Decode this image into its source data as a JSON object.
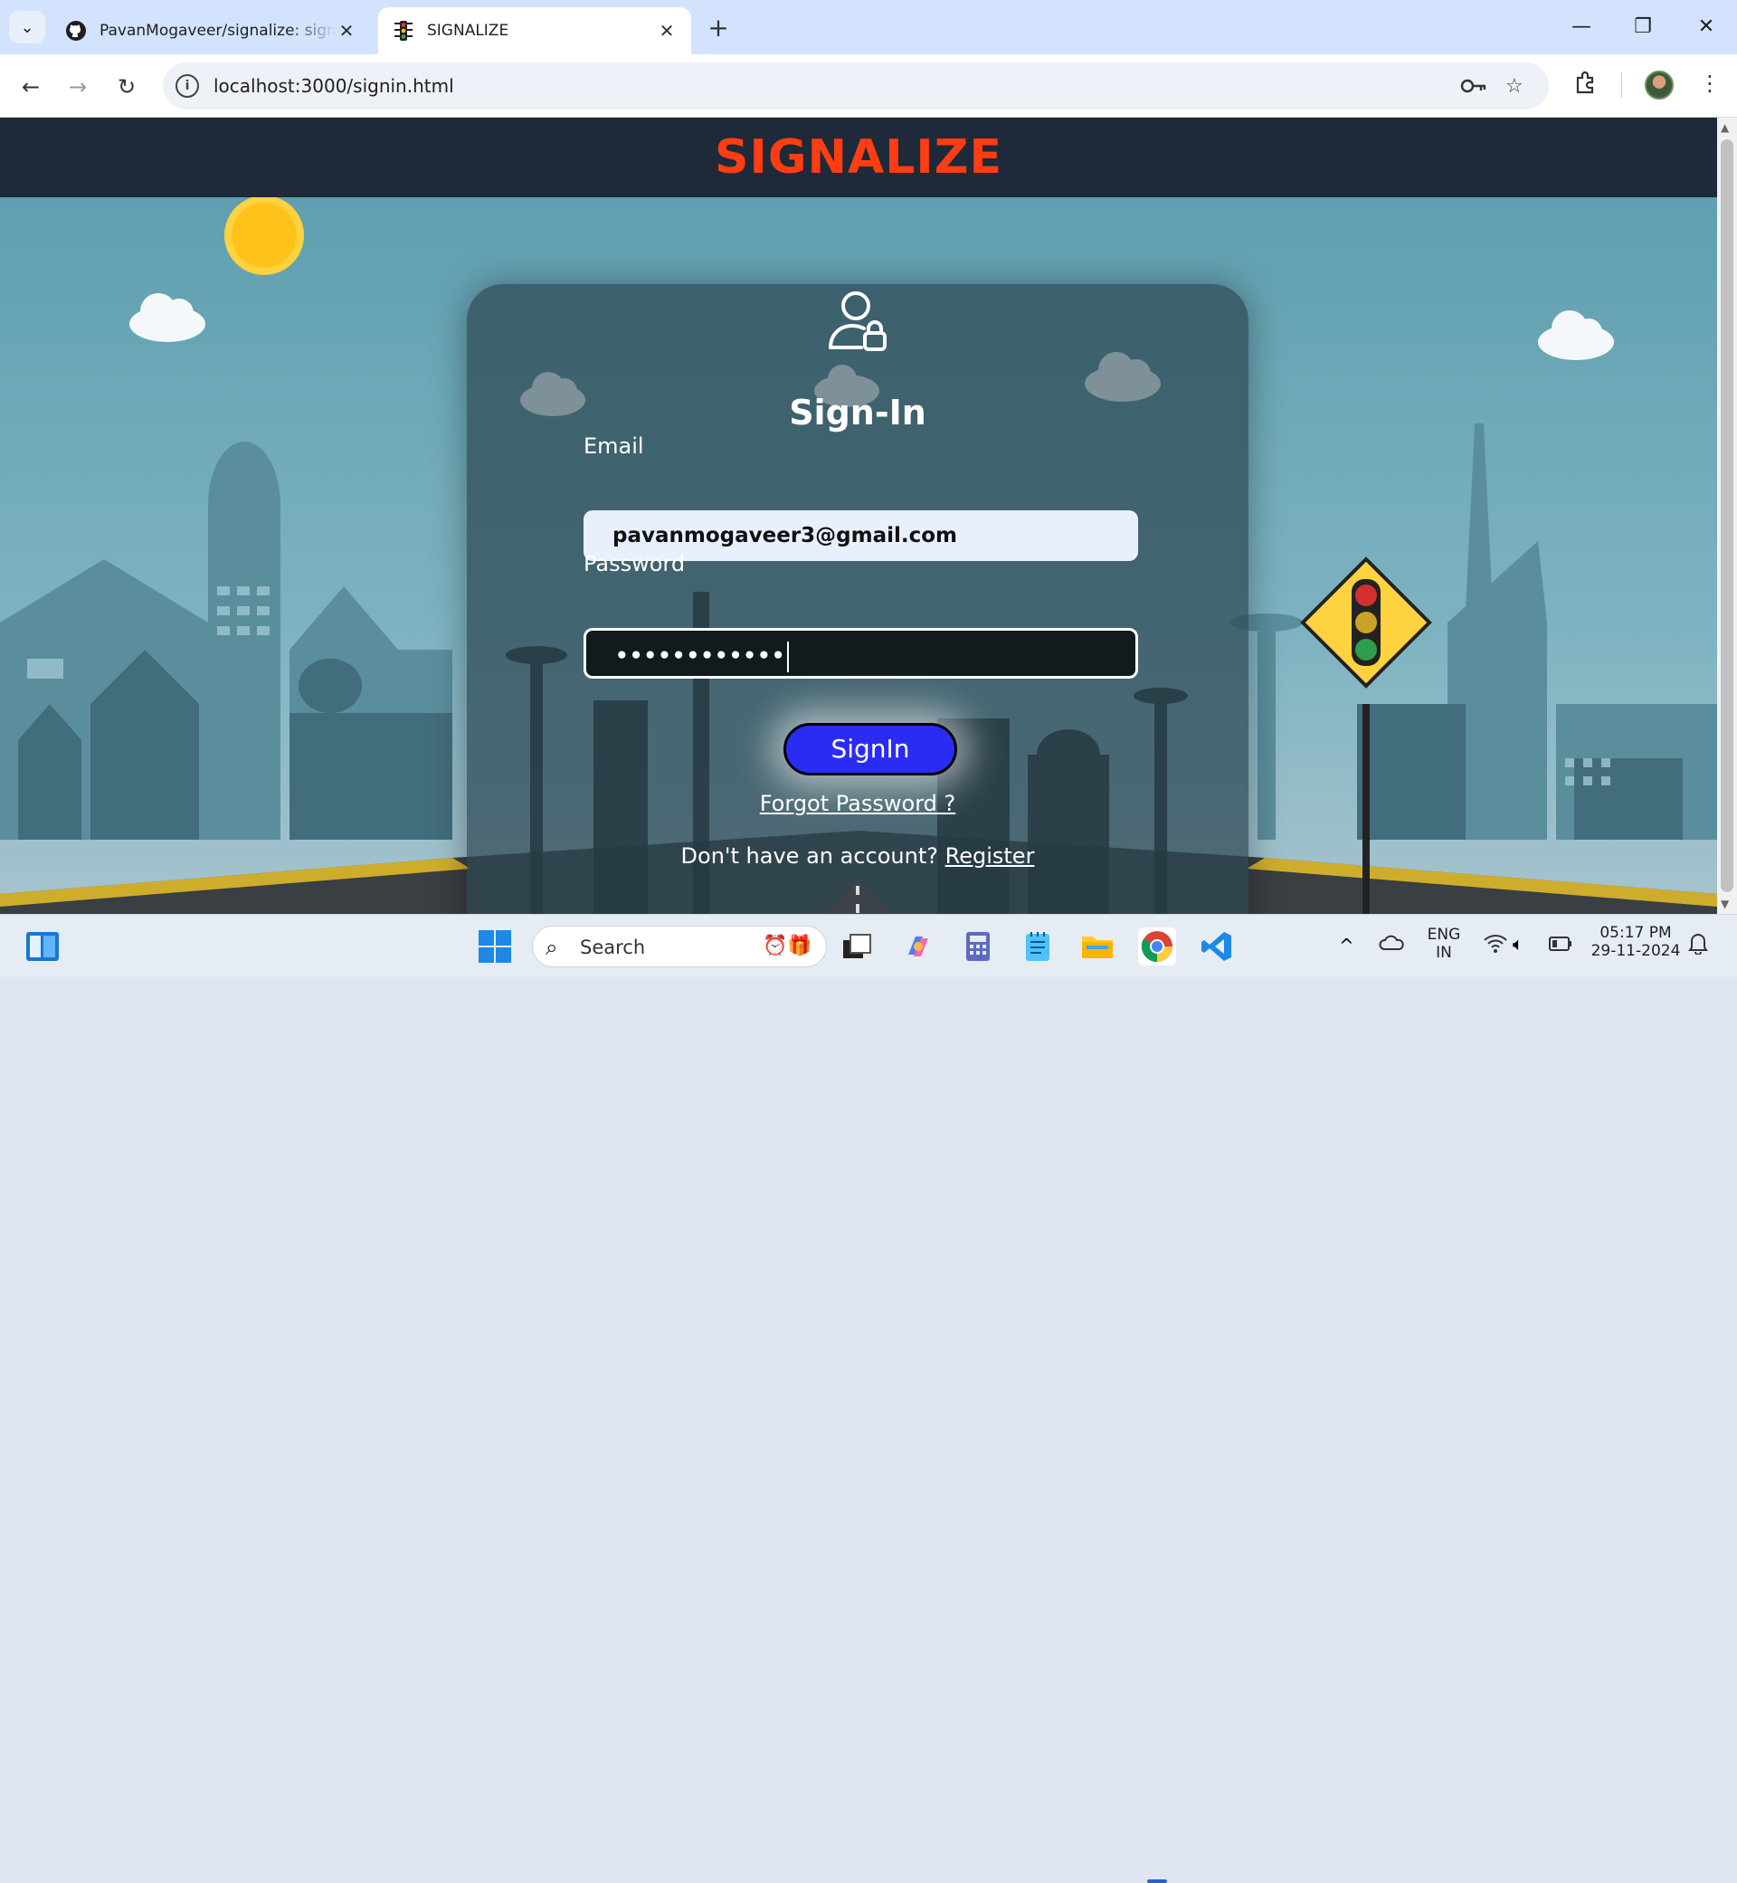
{
  "browser": {
    "tabs": [
      {
        "title": "PavanMogaveer/signalize: signa",
        "favicon": "github-icon"
      },
      {
        "title": "SIGNALIZE",
        "favicon": "traffic-light-icon"
      }
    ],
    "url": "localhost:3000/signin.html"
  },
  "site": {
    "logo": "SIGNALIZE"
  },
  "signin": {
    "title": "Sign-In",
    "email_label": "Email",
    "email_value": "pavanmogaveer3@gmail.com",
    "password_label": "Password",
    "password_value": "••••••••••••",
    "button": "SignIn",
    "forgot": "Forgot Password ?",
    "no_account": "Don't have an account?",
    "register": "Register"
  },
  "taskbar": {
    "search_placeholder": "Search",
    "lang_1": "ENG",
    "lang_2": "IN",
    "time": "05:17 PM",
    "date": "29-11-2024"
  },
  "colors": {
    "logo": "#ff3d12",
    "header_bg": "#1e2a39",
    "button": "#2b2cf3"
  }
}
